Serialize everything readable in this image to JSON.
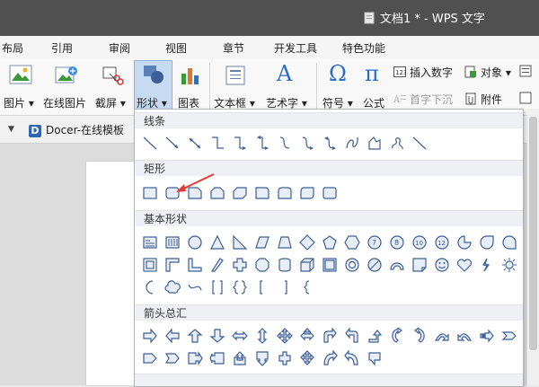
{
  "window": {
    "title": "文档1 * - WPS 文字"
  },
  "menubar": {
    "items": [
      "布局",
      "引用",
      "审阅",
      "视图",
      "章节",
      "开发工具",
      "特色功能"
    ]
  },
  "ribbon": {
    "buttons": [
      {
        "label": "图片 ▾",
        "icon": "picture-icon"
      },
      {
        "label": "在线图片",
        "icon": "online-picture-icon"
      },
      {
        "label": "截屏 ▾",
        "icon": "screenshot-icon"
      },
      {
        "label": "形状 ▾",
        "icon": "shapes-icon"
      },
      {
        "label": "图表",
        "icon": "chart-icon"
      },
      {
        "label": "文本框 ▾",
        "icon": "textbox-icon"
      },
      {
        "label": "艺术字 ▾",
        "icon": "wordart-icon"
      },
      {
        "label": "符号 ▾",
        "icon": "symbol-omega-icon"
      },
      {
        "label": "公式",
        "icon": "formula-pi-icon"
      }
    ],
    "small": [
      {
        "label": "插入数字",
        "icon": "insert-number-icon",
        "disabled": false
      },
      {
        "label": "首字下沉",
        "icon": "drop-cap-icon",
        "disabled": true
      },
      {
        "label": "对象 ▾",
        "icon": "object-icon",
        "disabled": false
      },
      {
        "label": "附件",
        "icon": "attachment-icon",
        "disabled": false
      }
    ]
  },
  "toolbar2": {
    "tab": "Docer-在线模板"
  },
  "shapes_panel": {
    "sections": [
      {
        "title": "线条",
        "count": 13
      },
      {
        "title": "矩形",
        "count": 9
      },
      {
        "title": "基本形状",
        "count": 42
      },
      {
        "title": "箭头总汇",
        "count": 28
      }
    ]
  },
  "colors": {
    "accent": "#2b6cc4",
    "selected_button_bg": "#c6daf2",
    "annotation_arrow": "#e53935",
    "shape_fill": "#e8eef8",
    "shape_stroke": "#3f5f94"
  }
}
